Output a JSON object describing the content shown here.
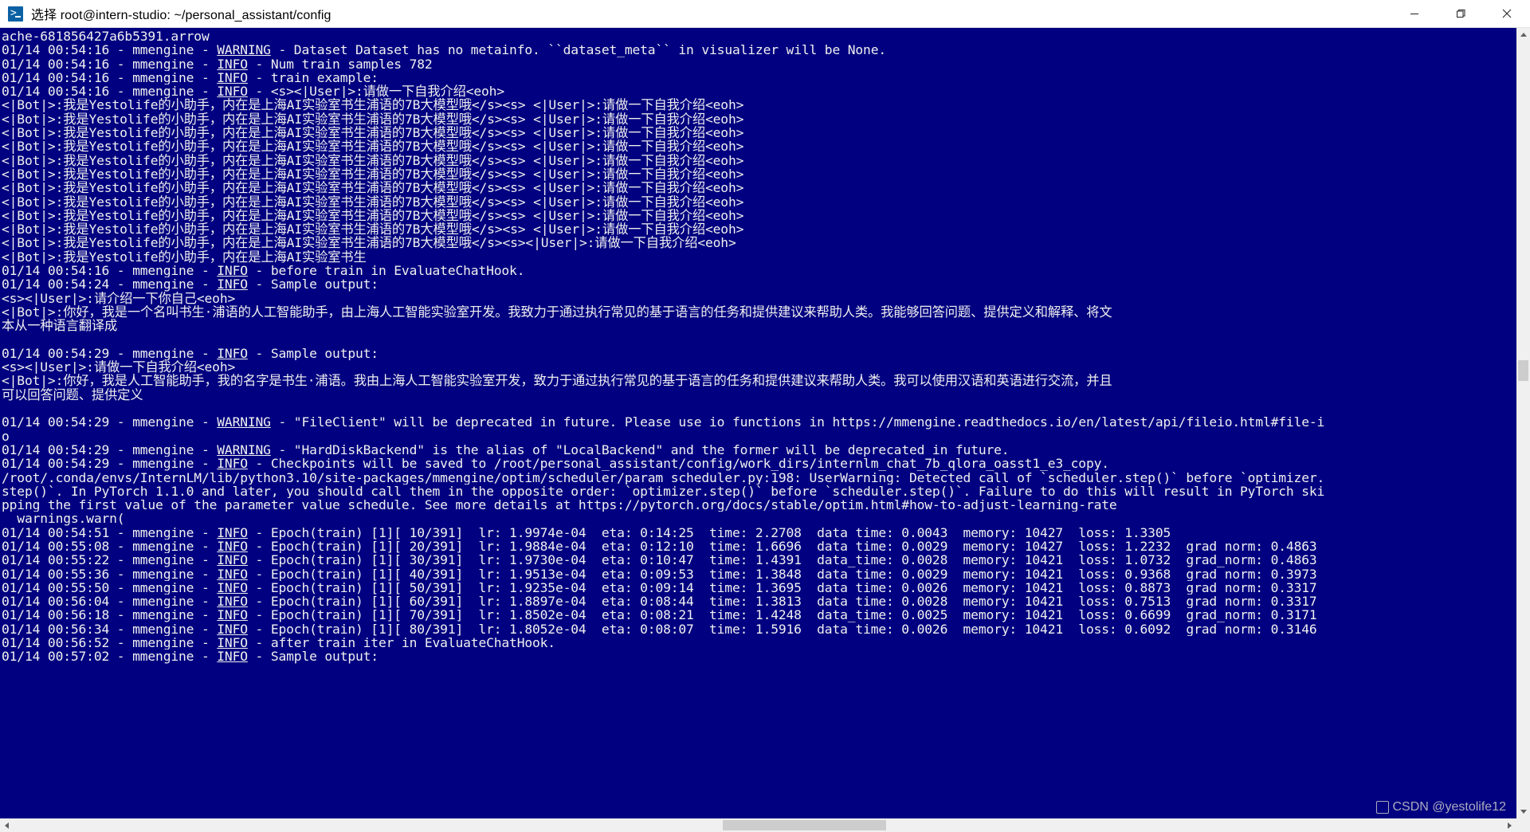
{
  "window": {
    "title": "选择 root@intern-studio: ~/personal_assistant/config",
    "icon": "command-prompt-icon",
    "minimize_label": "—",
    "maximize_label": "❐",
    "close_label": "✕",
    "colors": {
      "terminal_bg": "#000080",
      "terminal_fg": "#f0f0f0",
      "titlebar_bg": "#ffffff",
      "scrollbar_bg": "#f0f0f0",
      "scrollbar_thumb": "#cdcdcd"
    }
  },
  "scrollbars": {
    "vertical": {
      "up_icon": "chevron-up-icon",
      "down_icon": "chevron-down-icon"
    },
    "horizontal": {
      "left_icon": "chevron-left-icon",
      "right_icon": "chevron-right-icon"
    }
  },
  "watermark": "CSDN @yestolife12",
  "terminal": {
    "lines": [
      {
        "text": "ache-681856427a6b5391.arrow"
      },
      {
        "pre": "01/14 00:54:16 - mmengine - ",
        "level": "WARNING",
        "post": " - Dataset Dataset has no metainfo. ``dataset_meta`` in visualizer will be None."
      },
      {
        "pre": "01/14 00:54:16 - mmengine - ",
        "level": "INFO",
        "post": " - Num train samples 782"
      },
      {
        "pre": "01/14 00:54:16 - mmengine - ",
        "level": "INFO",
        "post": " - train example:"
      },
      {
        "pre": "01/14 00:54:16 - mmengine - ",
        "level": "INFO",
        "post": " - <s><|User|>:请做一下自我介绍<eoh>"
      },
      {
        "text": "<|Bot|>:我是Yestolife的小助手，内在是上海AI实验室书生浦语的7B大模型哦</s><s> <|User|>:请做一下自我介绍<eoh>"
      },
      {
        "text": "<|Bot|>:我是Yestolife的小助手，内在是上海AI实验室书生浦语的7B大模型哦</s><s> <|User|>:请做一下自我介绍<eoh>"
      },
      {
        "text": "<|Bot|>:我是Yestolife的小助手，内在是上海AI实验室书生浦语的7B大模型哦</s><s> <|User|>:请做一下自我介绍<eoh>"
      },
      {
        "text": "<|Bot|>:我是Yestolife的小助手，内在是上海AI实验室书生浦语的7B大模型哦</s><s> <|User|>:请做一下自我介绍<eoh>"
      },
      {
        "text": "<|Bot|>:我是Yestolife的小助手，内在是上海AI实验室书生浦语的7B大模型哦</s><s> <|User|>:请做一下自我介绍<eoh>"
      },
      {
        "text": "<|Bot|>:我是Yestolife的小助手，内在是上海AI实验室书生浦语的7B大模型哦</s><s> <|User|>:请做一下自我介绍<eoh>"
      },
      {
        "text": "<|Bot|>:我是Yestolife的小助手，内在是上海AI实验室书生浦语的7B大模型哦</s><s> <|User|>:请做一下自我介绍<eoh>"
      },
      {
        "text": "<|Bot|>:我是Yestolife的小助手，内在是上海AI实验室书生浦语的7B大模型哦</s><s> <|User|>:请做一下自我介绍<eoh>"
      },
      {
        "text": "<|Bot|>:我是Yestolife的小助手，内在是上海AI实验室书生浦语的7B大模型哦</s><s> <|User|>:请做一下自我介绍<eoh>"
      },
      {
        "text": "<|Bot|>:我是Yestolife的小助手，内在是上海AI实验室书生浦语的7B大模型哦</s><s> <|User|>:请做一下自我介绍<eoh>"
      },
      {
        "text": "<|Bot|>:我是Yestolife的小助手，内在是上海AI实验室书生浦语的7B大模型哦</s><s><|User|>:请做一下自我介绍<eoh>"
      },
      {
        "text": "<|Bot|>:我是Yestolife的小助手，内在是上海AI实验室书生"
      },
      {
        "pre": "01/14 00:54:16 - mmengine - ",
        "level": "INFO",
        "post": " - before_train in EvaluateChatHook."
      },
      {
        "pre": "01/14 00:54:24 - mmengine - ",
        "level": "INFO",
        "post": " - Sample output:"
      },
      {
        "text": "<s><|User|>:请介绍一下你自己<eoh>"
      },
      {
        "text": "<|Bot|>:你好，我是一个名叫书生·浦语的人工智能助手，由上海人工智能实验室开发。我致力于通过执行常见的基于语言的任务和提供建议来帮助人类。我能够回答问题、提供定义和解释、将文"
      },
      {
        "text": "本从一种语言翻译成"
      },
      {
        "text": ""
      },
      {
        "pre": "01/14 00:54:29 - mmengine - ",
        "level": "INFO",
        "post": " - Sample output:"
      },
      {
        "text": "<s><|User|>:请做一下自我介绍<eoh>"
      },
      {
        "text": "<|Bot|>:你好，我是人工智能助手，我的名字是书生·浦语。我由上海人工智能实验室开发，致力于通过执行常见的基于语言的任务和提供建议来帮助人类。我可以使用汉语和英语进行交流，并且"
      },
      {
        "text": "可以回答问题、提供定义"
      },
      {
        "text": ""
      },
      {
        "pre": "01/14 00:54:29 - mmengine - ",
        "level": "WARNING",
        "post": " - \"FileClient\" will be deprecated in future. Please use io functions in https://mmengine.readthedocs.io/en/latest/api/fileio.html#file-i"
      },
      {
        "text": "o"
      },
      {
        "pre": "01/14 00:54:29 - mmengine - ",
        "level": "WARNING",
        "post": " - \"HardDiskBackend\" is the alias of \"LocalBackend\" and the former will be deprecated in future."
      },
      {
        "pre": "01/14 00:54:29 - mmengine - ",
        "level": "INFO",
        "post": " - Checkpoints will be saved to /root/personal_assistant/config/work_dirs/internlm_chat_7b_qlora_oasst1_e3_copy."
      },
      {
        "text": "/root/.conda/envs/InternLM/lib/python3.10/site-packages/mmengine/optim/scheduler/param_scheduler.py:198: UserWarning: Detected call of `scheduler.step()` before `optimizer."
      },
      {
        "text": "step()`. In PyTorch 1.1.0 and later, you should call them in the opposite order: `optimizer.step()` before `scheduler.step()`. Failure to do this will result in PyTorch ski"
      },
      {
        "text": "pping the first value of the parameter value schedule. See more details at https://pytorch.org/docs/stable/optim.html#how-to-adjust-learning-rate"
      },
      {
        "text": "  warnings.warn("
      },
      {
        "pre": "01/14 00:54:51 - mmengine - ",
        "level": "INFO",
        "post": " - Epoch(train) [1][ 10/391]  lr: 1.9974e-04  eta: 0:14:25  time: 2.2708  data_time: 0.0043  memory: 10427  loss: 1.3305"
      },
      {
        "pre": "01/14 00:55:08 - mmengine - ",
        "level": "INFO",
        "post": " - Epoch(train) [1][ 20/391]  lr: 1.9884e-04  eta: 0:12:10  time: 1.6696  data_time: 0.0029  memory: 10427  loss: 1.2232  grad_norm: 0.4863"
      },
      {
        "pre": "01/14 00:55:22 - mmengine - ",
        "level": "INFO",
        "post": " - Epoch(train) [1][ 30/391]  lr: 1.9730e-04  eta: 0:10:47  time: 1.4391  data_time: 0.0028  memory: 10421  loss: 1.0732  grad_norm: 0.4863"
      },
      {
        "pre": "01/14 00:55:36 - mmengine - ",
        "level": "INFO",
        "post": " - Epoch(train) [1][ 40/391]  lr: 1.9513e-04  eta: 0:09:53  time: 1.3848  data_time: 0.0029  memory: 10421  loss: 0.9368  grad_norm: 0.3973"
      },
      {
        "pre": "01/14 00:55:50 - mmengine - ",
        "level": "INFO",
        "post": " - Epoch(train) [1][ 50/391]  lr: 1.9235e-04  eta: 0:09:14  time: 1.3695  data_time: 0.0026  memory: 10421  loss: 0.8873  grad_norm: 0.3317"
      },
      {
        "pre": "01/14 00:56:04 - mmengine - ",
        "level": "INFO",
        "post": " - Epoch(train) [1][ 60/391]  lr: 1.8897e-04  eta: 0:08:44  time: 1.3813  data_time: 0.0028  memory: 10421  loss: 0.7513  grad_norm: 0.3317"
      },
      {
        "pre": "01/14 00:56:18 - mmengine - ",
        "level": "INFO",
        "post": " - Epoch(train) [1][ 70/391]  lr: 1.8502e-04  eta: 0:08:21  time: 1.4248  data_time: 0.0025  memory: 10421  loss: 0.6699  grad_norm: 0.3171"
      },
      {
        "pre": "01/14 00:56:34 - mmengine - ",
        "level": "INFO",
        "post": " - Epoch(train) [1][ 80/391]  lr: 1.8052e-04  eta: 0:08:07  time: 1.5916  data_time: 0.0026  memory: 10421  loss: 0.6092  grad_norm: 0.3146"
      },
      {
        "pre": "01/14 00:56:52 - mmengine - ",
        "level": "INFO",
        "post": " - after_train_iter in EvaluateChatHook."
      },
      {
        "pre": "01/14 00:57:02 - mmengine - ",
        "level": "INFO",
        "post": " - Sample output:"
      }
    ]
  }
}
